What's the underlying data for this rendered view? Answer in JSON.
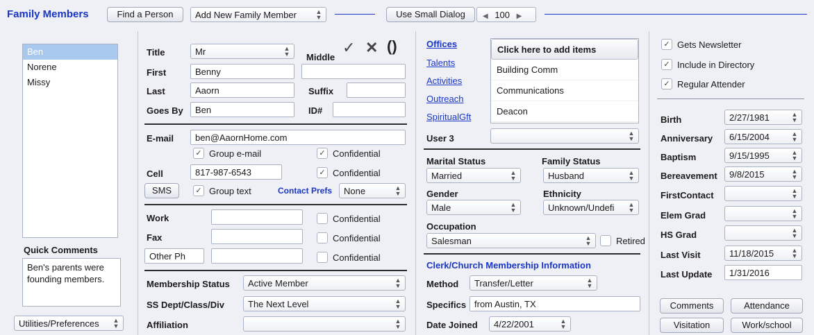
{
  "header": {
    "title": "Family Members",
    "find_button": "Find a Person",
    "add_select": "Add New Family Member",
    "small_dialog_button": "Use Small Dialog",
    "zoom_value": "100"
  },
  "sidebar": {
    "members": [
      "Ben",
      "Norene",
      "Missy"
    ],
    "quick_comments_label": "Quick Comments",
    "quick_comments_text": "Ben's parents were founding members.",
    "utilities_select": "Utilities/Preferences"
  },
  "person": {
    "title_label": "Title",
    "title_value": "Mr",
    "middle_label": "Middle",
    "middle_value": "",
    "first_label": "First",
    "first_value": "Benny",
    "last_label": "Last",
    "last_value": "Aaorn",
    "suffix_label": "Suffix",
    "suffix_value": "",
    "goesby_label": "Goes By",
    "goesby_value": "Ben",
    "id_label": "ID#",
    "id_value": ""
  },
  "contact": {
    "email_label": "E-mail",
    "email_value": "ben@AaornHome.com",
    "group_email": "Group e-mail",
    "confidential": "Confidential",
    "cell_label": "Cell",
    "cell_value": "817-987-6543",
    "sms_button": "SMS",
    "group_text": "Group text",
    "contact_prefs_label": "Contact Prefs",
    "contact_prefs_value": "None",
    "work_label": "Work",
    "fax_label": "Fax",
    "other_ph_value": "Other Ph"
  },
  "membership": {
    "status_label": "Membership Status",
    "status_value": "Active Member",
    "ss_label": "SS Dept/Class/Div",
    "ss_value": "The Next Level",
    "affiliation_label": "Affiliation",
    "affiliation_value": ""
  },
  "ministry": {
    "links": [
      "Offices",
      "Talents",
      "Activities",
      "Outreach",
      "SpiritualGft"
    ],
    "add_items": "Click here to add items",
    "items": [
      "Building Comm",
      "Communications",
      "Deacon"
    ],
    "user3_label": "User 3"
  },
  "family": {
    "marital_label": "Marital Status",
    "marital_value": "Married",
    "family_label": "Family Status",
    "family_value": "Husband",
    "gender_label": "Gender",
    "gender_value": "Male",
    "ethnicity_label": "Ethnicity",
    "ethnicity_value": "Unknown/Undefi",
    "occupation_label": "Occupation",
    "occupation_value": "Salesman",
    "retired_label": "Retired"
  },
  "clerk": {
    "header": "Clerk/Church Membership Information",
    "method_label": "Method",
    "method_value": "Transfer/Letter",
    "specifics_label": "Specifics",
    "specifics_value": "from Austin, TX",
    "joined_label": "Date Joined",
    "joined_value": "4/22/2001"
  },
  "flags": {
    "newsletter": "Gets Newsletter",
    "directory": "Include in Directory",
    "attender": "Regular Attender"
  },
  "dates": [
    {
      "label": "Birth",
      "value": "2/27/1981"
    },
    {
      "label": "Anniversary",
      "value": "6/15/2004"
    },
    {
      "label": "Baptism",
      "value": "9/15/1995"
    },
    {
      "label": "Bereavement",
      "value": "9/8/2015"
    },
    {
      "label": "FirstContact",
      "value": ""
    },
    {
      "label": "Elem Grad",
      "value": ""
    },
    {
      "label": "HS Grad",
      "value": ""
    },
    {
      "label": "Last Visit",
      "value": "11/18/2015"
    },
    {
      "label": "Last Update",
      "value": "1/31/2016"
    }
  ],
  "buttons": {
    "comments": "Comments",
    "attendance": "Attendance",
    "visitation": "Visitation",
    "work_school": "Work/school"
  }
}
